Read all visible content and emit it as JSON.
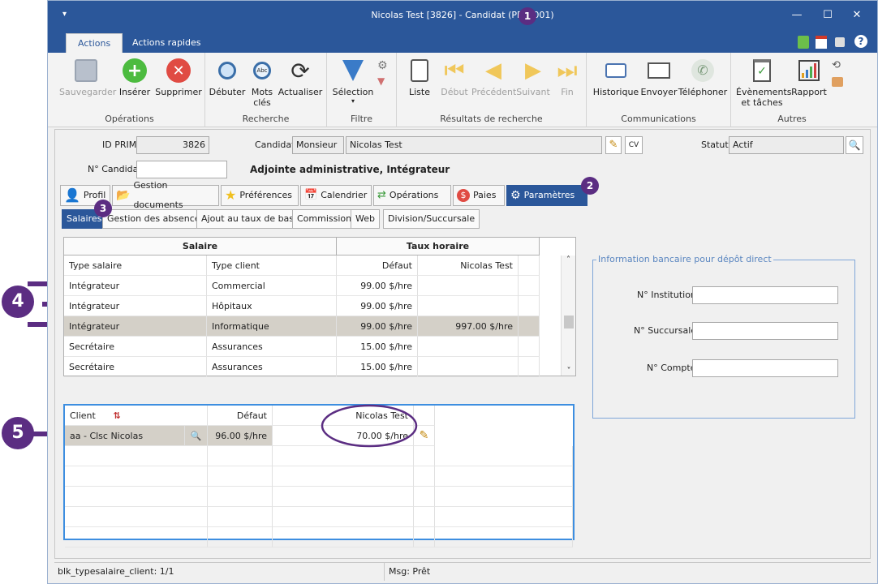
{
  "window": {
    "title": "Nicolas Test [3826] - Candidat (PRIM001)",
    "badge": "1"
  },
  "ribbon_tabs": [
    {
      "label": "Actions"
    },
    {
      "label": "Actions rapides"
    }
  ],
  "ribbon": {
    "operations": {
      "caption": "Opérations",
      "save": "Sauvegarder",
      "insert": "Insérer",
      "delete": "Supprimer"
    },
    "search": {
      "caption": "Recherche",
      "start": "Débuter",
      "keywords": "Mots\nclés",
      "refresh": "Actualiser"
    },
    "filter": {
      "caption": "Filtre",
      "selection": "Sélection"
    },
    "results": {
      "caption": "Résultats de recherche",
      "list": "Liste",
      "first": "Début",
      "prev": "Précédent",
      "next": "Suivant",
      "last": "Fin"
    },
    "comms": {
      "caption": "Communications",
      "history": "Historique",
      "send": "Envoyer",
      "phone": "Téléphoner"
    },
    "other": {
      "caption": "Autres",
      "events": "Évènements\net tâches",
      "report": "Rapport"
    }
  },
  "header": {
    "id_label": "ID PRIM",
    "id_value": "3826",
    "candidate_label": "Candidat",
    "salutation": "Monsieur",
    "name": "Nicolas Test",
    "status_label": "Statut",
    "status_value": "Actif",
    "number_label": "N° Candidat",
    "number_value": "",
    "job_title": "Adjointe administrative, Intégrateur",
    "cv": "CV"
  },
  "main_tabs": [
    "Profil",
    "Gestion documents",
    "Préférences",
    "Calendrier",
    "Opérations",
    "Paies",
    "Paramètres"
  ],
  "main_tab_badge": "2",
  "sub_tabs": [
    "Salaires",
    "Gestion des absences",
    "Ajout au taux de base",
    "Commissions",
    "Web",
    "Division/Succursale"
  ],
  "sub_tab_badge": "3",
  "salary_grid": {
    "group_headers": [
      "Salaire",
      "Taux horaire"
    ],
    "columns": [
      "Type salaire",
      "Type client",
      "Défaut",
      "Nicolas Test"
    ],
    "rows": [
      [
        "Intégrateur",
        "Commercial",
        "99.00 $/hre",
        ""
      ],
      [
        "Intégrateur",
        "Hôpitaux",
        "99.00 $/hre",
        ""
      ],
      [
        "Intégrateur",
        "Informatique",
        "99.00 $/hre",
        "997.00 $/hre"
      ],
      [
        "Secrétaire",
        "Assurances",
        "15.00 $/hre",
        ""
      ],
      [
        "Secrétaire",
        "Assurances",
        "15.00 $/hre",
        ""
      ]
    ],
    "selected_row": 2,
    "badge": "4"
  },
  "client_grid": {
    "columns": [
      "Client",
      "Défaut",
      "Nicolas Test"
    ],
    "rows": [
      [
        "aa - Clsc Nicolas",
        "96.00 $/hre",
        "70.00 $/hre"
      ]
    ],
    "badge": "5"
  },
  "bank": {
    "legend": "Information bancaire pour dépôt direct",
    "institution_label": "N° Institution",
    "branch_label": "N° Succursale",
    "account_label": "N° Compte"
  },
  "status": {
    "block": "blk_typesalaire_client: 1/1",
    "msg": "Msg: Prêt"
  },
  "colors": {
    "accent": "#2b579a",
    "badge": "#5b2d82",
    "selected_row": "#d4d0c8",
    "focus_border": "#3d8ee0"
  }
}
